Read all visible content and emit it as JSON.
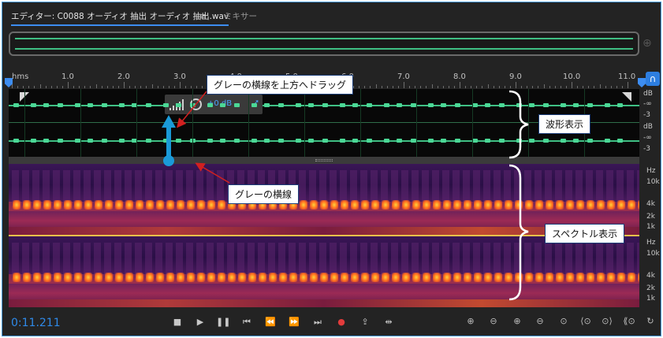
{
  "tabs": {
    "editor_label": "エディター: C0088 オーディオ 抽出 オーディオ 抽出.wav",
    "menu_glyph": "≡",
    "mixer_label": "ミキサー"
  },
  "ruler": {
    "unit_label": "hms",
    "labels": [
      "1.0",
      "2.0",
      "3.0",
      "4.0",
      "5.0",
      "6.0",
      "7.0",
      "8.0",
      "9.0",
      "10.0",
      "11.0"
    ]
  },
  "hud": {
    "gain_label": "+0 dB"
  },
  "db_scale": {
    "upper": [
      "dB",
      "-∞",
      "-3"
    ],
    "lower": [
      "dB",
      "-∞",
      "-3"
    ]
  },
  "hz_scale": {
    "upper": [
      "Hz",
      "10k",
      "4k",
      "2k",
      "1k"
    ],
    "lower": [
      "Hz",
      "10k",
      "4k",
      "2k",
      "1k"
    ]
  },
  "transport": {
    "timecode": "0:11.211",
    "stop_icon": "stop-icon",
    "play_icon": "play-icon",
    "pause_icon": "pause-icon",
    "record_color": "#e23b3b"
  },
  "annotations": {
    "drag_instruction": "グレーの横線を上方へドラッグ",
    "gray_line": "グレーの横線",
    "waveform_display": "波形表示",
    "spectral_display": "スペクトル表示"
  },
  "colors": {
    "accent_blue": "#2f8ae8",
    "waveform_green": "#3fbf84",
    "annotation_blue": "#1a9ad8",
    "annotation_red": "#d12020"
  }
}
